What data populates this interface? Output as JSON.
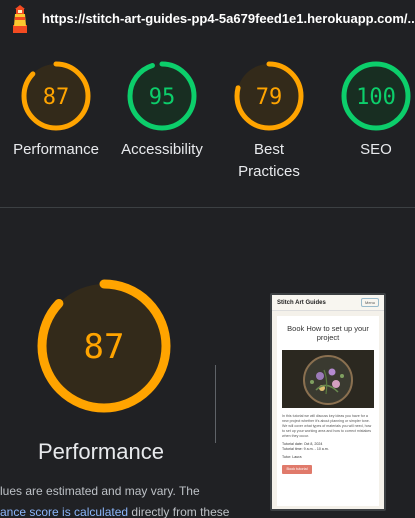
{
  "header": {
    "url": "https://stitch-art-guides-pp4-5a679feed1e1.herokuapp.com/..."
  },
  "colors": {
    "average": "#ffa400",
    "pass": "#0cce6b",
    "background": "#202124"
  },
  "gauges": [
    {
      "score": "87",
      "label": "Performance",
      "status": "average",
      "fraction": 0.87
    },
    {
      "score": "95",
      "label": "Accessibility",
      "status": "pass",
      "fraction": 0.95
    },
    {
      "score": "79",
      "label": "Best Practices",
      "status": "average",
      "fraction": 0.79
    },
    {
      "score": "100",
      "label": "SEO",
      "status": "pass",
      "fraction": 1.0
    }
  ],
  "performance": {
    "score": "87",
    "fraction": 0.87,
    "title": "Performance",
    "desc_line1": "lues are estimated and may vary. The",
    "desc_link": "ance score is calculated",
    "desc_line2_rest": " directly from these"
  },
  "thumbnail": {
    "brand": "Stitch Art Guides",
    "menu": "Menu",
    "heading": "Book How to set up your project",
    "body": "In this tutorial we will discuss key ideas you have for a new project whether it's about planning or simpler tone. We will cover what types of materials you will need, how to set up your working area and how to correct mistakes when they occur.",
    "date": "Tutorial date: Oct 8, 2024",
    "time": "Tutorial time: 9 a.m. - 10 a.m.",
    "tutor": "Tutor: Laura",
    "button": "Book tutorial"
  }
}
